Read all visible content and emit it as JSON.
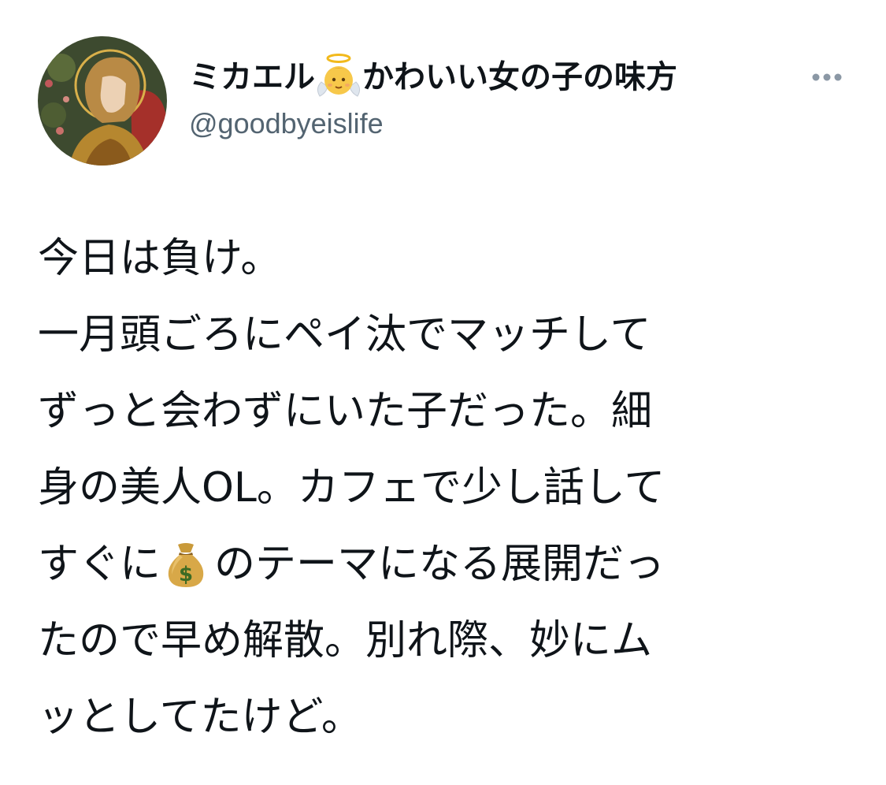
{
  "tweet": {
    "author": {
      "name_part1": "ミカエル",
      "name_emoji": "baby-angel-emoji",
      "name_part2": "かわいい女の子の味方",
      "handle": "@goodbyeislife",
      "avatar": "angel-painting-avatar"
    },
    "more_icon": "more-options-icon",
    "text_lines": [
      "今日は負け。",
      "一月頭ごろにペイ汰でマッチして",
      "ずっと会わずにいた子だった。細",
      "身の美人OL。カフェで少し話して",
      {
        "before": "すぐに",
        "emoji": "money-bag-emoji",
        "after": "のテーマになる展開だっ"
      },
      "たので早め解散。別れ際、妙にム",
      "ッとしてたけど。"
    ]
  }
}
